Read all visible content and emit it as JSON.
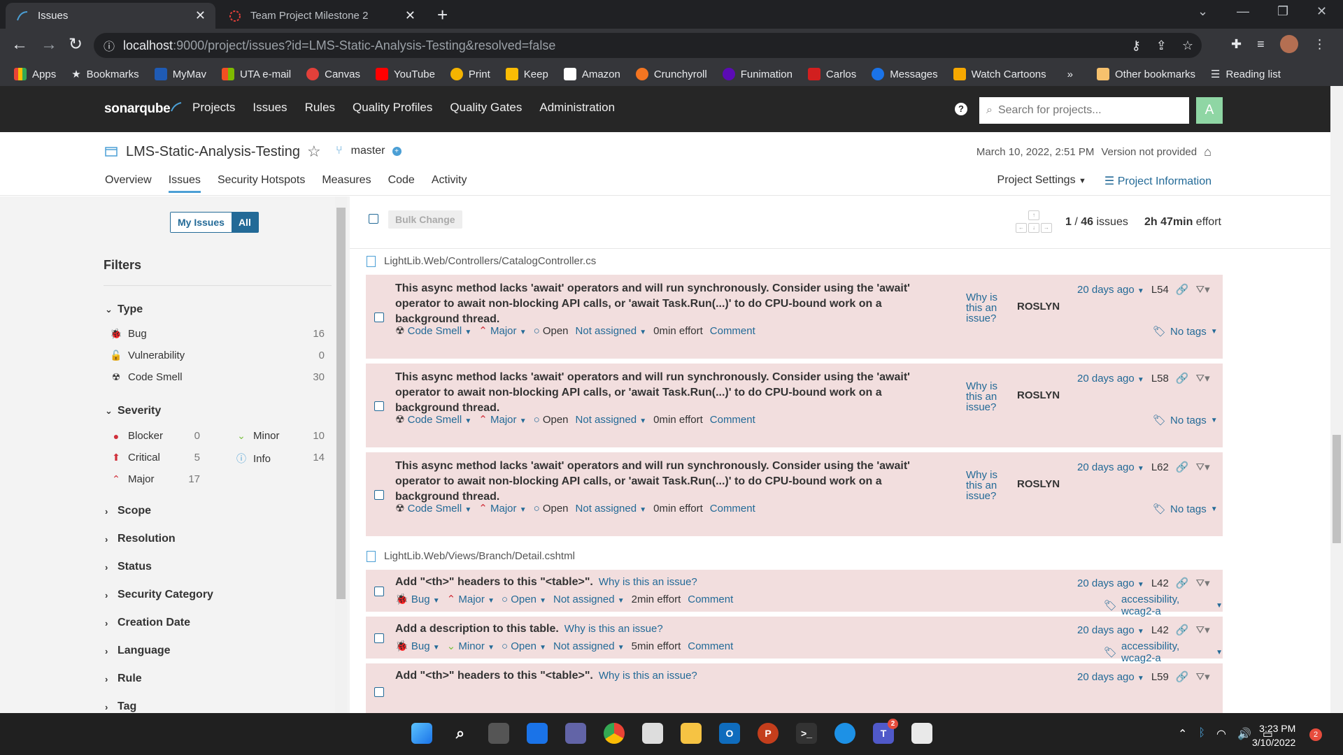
{
  "browser": {
    "tabs": [
      {
        "title": "Issues",
        "active": true
      },
      {
        "title": "Team Project Milestone 2",
        "active": false
      }
    ],
    "url_host": "localhost",
    "url_path": ":9000/project/issues?id=LMS-Static-Analysis-Testing&resolved=false",
    "bookmarks": [
      "Apps",
      "Bookmarks",
      "MyMav",
      "UTA e-mail",
      "Canvas",
      "YouTube",
      "Print",
      "Keep",
      "Amazon",
      "Crunchyroll",
      "Funimation",
      "Carlos",
      "Messages",
      "Watch Cartoons"
    ],
    "other_bookmarks": "Other bookmarks",
    "reading_list": "Reading list",
    "overflow": "»"
  },
  "sonar": {
    "logo_bold": "sonar",
    "logo_rest": "qube",
    "nav": [
      "Projects",
      "Issues",
      "Rules",
      "Quality Profiles",
      "Quality Gates",
      "Administration"
    ],
    "search_placeholder": "Search for projects...",
    "avatar_letter": "A"
  },
  "project": {
    "name": "LMS-Static-Analysis-Testing",
    "branch": "master",
    "date": "March 10, 2022, 2:51 PM",
    "version": "Version not provided",
    "tabs": [
      "Overview",
      "Issues",
      "Security Hotspots",
      "Measures",
      "Code",
      "Activity"
    ],
    "settings": "Project Settings",
    "info": "Project Information"
  },
  "sidebar": {
    "my_issues": "My Issues",
    "all": "All",
    "filters_title": "Filters",
    "type_title": "Type",
    "types": [
      {
        "label": "Bug",
        "count": "16"
      },
      {
        "label": "Vulnerability",
        "count": "0"
      },
      {
        "label": "Code Smell",
        "count": "30"
      }
    ],
    "severity_title": "Severity",
    "severities_left": [
      {
        "label": "Blocker",
        "count": "0"
      },
      {
        "label": "Critical",
        "count": "5"
      },
      {
        "label": "Major",
        "count": "17"
      }
    ],
    "severities_right": [
      {
        "label": "Minor",
        "count": "10"
      },
      {
        "label": "Info",
        "count": "14"
      }
    ],
    "collapsed": [
      "Scope",
      "Resolution",
      "Status",
      "Security Category",
      "Creation Date",
      "Language",
      "Rule",
      "Tag"
    ]
  },
  "toolbar": {
    "bulk_change": "Bulk Change",
    "count_current": "1",
    "count_sep": " / ",
    "count_total": "46",
    "count_suffix": " issues",
    "effort_value": "2h 47min",
    "effort_suffix": " effort"
  },
  "files": [
    "LightLib.Web/Controllers/CatalogController.cs",
    "LightLib.Web/Views/Branch/Detail.cshtml"
  ],
  "issues": [
    {
      "msg1": "This async method lacks 'await' operators and will run synchronously. Consider using the 'await'",
      "msg2": "operator to await non-blocking API calls, or 'await Task.Run(...)' to do CPU-bound work on a",
      "msg3": "background thread.",
      "why1": "Why is",
      "why2": "this an",
      "why3": "issue?",
      "engine": "ROSLYN",
      "ago": "20 days ago",
      "line": "L54",
      "type": "Code Smell",
      "severity": "Major",
      "status": "Open",
      "assignee": "Not assigned",
      "effort": "0min effort",
      "comment": "Comment",
      "tags": "No tags"
    },
    {
      "msg1": "This async method lacks 'await' operators and will run synchronously. Consider using the 'await'",
      "msg2": "operator to await non-blocking API calls, or 'await Task.Run(...)' to do CPU-bound work on a",
      "msg3": "background thread.",
      "why1": "Why is",
      "why2": "this an",
      "why3": "issue?",
      "engine": "ROSLYN",
      "ago": "20 days ago",
      "line": "L58",
      "type": "Code Smell",
      "severity": "Major",
      "status": "Open",
      "assignee": "Not assigned",
      "effort": "0min effort",
      "comment": "Comment",
      "tags": "No tags"
    },
    {
      "msg1": "This async method lacks 'await' operators and will run synchronously. Consider using the 'await'",
      "msg2": "operator to await non-blocking API calls, or 'await Task.Run(...)' to do CPU-bound work on a",
      "msg3": "background thread.",
      "why1": "Why is",
      "why2": "this an",
      "why3": "issue?",
      "engine": "ROSLYN",
      "ago": "20 days ago",
      "line": "L62",
      "type": "Code Smell",
      "severity": "Major",
      "status": "Open",
      "assignee": "Not assigned",
      "effort": "0min effort",
      "comment": "Comment",
      "tags": "No tags"
    },
    {
      "msg": "Add \"<th>\" headers to this \"<table>\".",
      "why": "Why is this an issue?",
      "ago": "20 days ago",
      "line": "L42",
      "type": "Bug",
      "severity": "Major",
      "status": "Open",
      "assignee": "Not assigned",
      "effort": "2min effort",
      "comment": "Comment",
      "tags": "accessibility, wcag2-a"
    },
    {
      "msg": "Add a description to this table.",
      "why": "Why is this an issue?",
      "ago": "20 days ago",
      "line": "L42",
      "type": "Bug",
      "severity": "Minor",
      "status": "Open",
      "assignee": "Not assigned",
      "effort": "5min effort",
      "comment": "Comment",
      "tags": "accessibility, wcag2-a"
    },
    {
      "msg": "Add \"<th>\" headers to this \"<table>\".",
      "why": "Why is this an issue?",
      "ago": "20 days ago",
      "line": "L59"
    }
  ],
  "taskbar": {
    "time": "3:23 PM",
    "date": "3/10/2022",
    "notifications": "2",
    "teams_badge": "2"
  },
  "colors": {
    "issue_bg": "#f2dede",
    "link": "#236a97",
    "nav_bg": "#262626",
    "major": "#d02f3a",
    "minor": "#7bc142",
    "info": "#4b9fd5"
  }
}
